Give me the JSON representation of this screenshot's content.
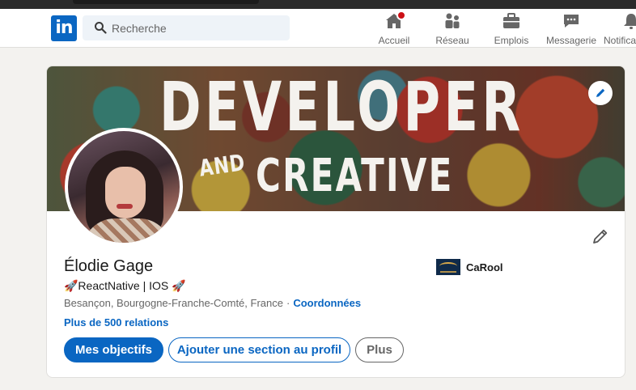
{
  "nav": {
    "search_placeholder": "Recherche",
    "items": [
      {
        "label": "Accueil",
        "icon": "home-icon"
      },
      {
        "label": "Réseau",
        "icon": "network-icon"
      },
      {
        "label": "Emplois",
        "icon": "briefcase-icon"
      },
      {
        "label": "Messagerie",
        "icon": "messaging-icon"
      },
      {
        "label": "Notifica",
        "icon": "bell-icon"
      }
    ],
    "logo_text": "in"
  },
  "profile": {
    "banner_line1": "DEVELOPER",
    "banner_and": "AND",
    "banner_line2": "CREATIVE",
    "name": "Élodie Gage",
    "headline": "🚀ReactNative | IOS 🚀",
    "location": "Besançon, Bourgogne-Franche-Comté, France",
    "separator": "·",
    "contact_link": "Coordonnées",
    "relations": "Plus de 500 relations",
    "company": "CaRool",
    "buttons": {
      "primary": "Mes objectifs",
      "secondary": "Ajouter une section au profil",
      "more": "Plus"
    }
  },
  "colors": {
    "brand_blue": "#0a66c2",
    "notification_red": "#cc1016",
    "page_bg": "#f3f2ef"
  }
}
